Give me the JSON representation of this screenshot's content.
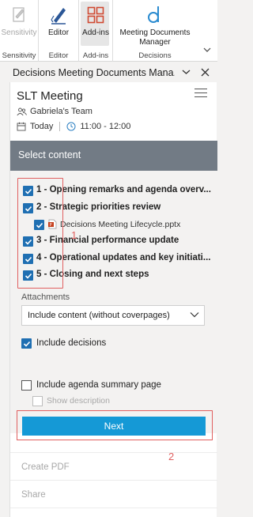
{
  "ribbon": {
    "sensitivity": {
      "label": "Sensitivity",
      "group": "Sensitivity"
    },
    "editor": {
      "label": "Editor",
      "group": "Editor"
    },
    "addins": {
      "label": "Add-ins",
      "group": "Add-ins"
    },
    "decisions": {
      "label": "Meeting Documents Manager",
      "group": "Decisions"
    }
  },
  "pane": {
    "title": "Decisions Meeting Documents Mana...",
    "meeting_title": "SLT Meeting",
    "team": "Gabriela's Team",
    "date": "Today",
    "time": "11:00 - 12:00",
    "select_content": "Select content",
    "items": [
      {
        "label": "1 - Opening remarks and agenda overv..."
      },
      {
        "label": "2 - Strategic priorities review"
      },
      {
        "label": "3 - Financial performance update"
      },
      {
        "label": "4 - Operational updates and key initiati..."
      },
      {
        "label": "5 - Closing and next steps"
      }
    ],
    "attachment_file": "Decisions Meeting Lifecycle.pptx",
    "attachments_label": "Attachments",
    "attachments_value": "Include content (without coverpages)",
    "include_decisions": "Include decisions",
    "include_summary": "Include agenda summary page",
    "show_description": "Show description",
    "next_label": "Next",
    "create_pdf": "Create PDF",
    "share": "Share"
  },
  "annotations": {
    "box1": "1",
    "box2": "2"
  },
  "colors": {
    "accent": "#1f6fb2",
    "next_button": "#1599d6",
    "select_bar": "#727b85",
    "annotation": "#e06060"
  }
}
